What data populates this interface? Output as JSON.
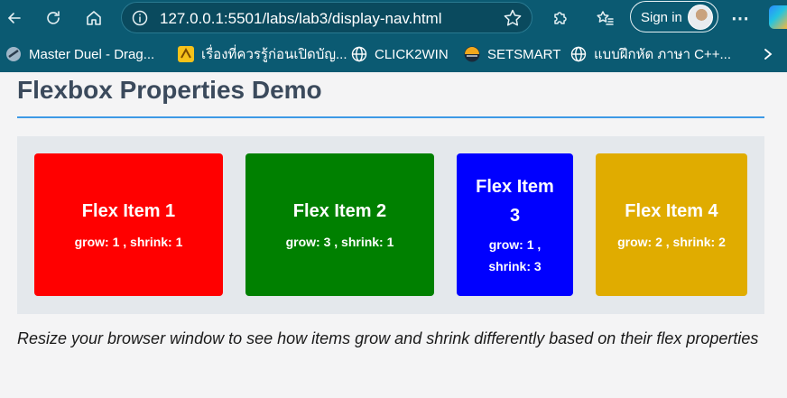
{
  "browser": {
    "url": "127.0.0.1:5501/labs/lab3/display-nav.html",
    "signin_label": "Sign in",
    "more_label": "⋯",
    "bookmarks": [
      {
        "label": "Master Duel - Drag...",
        "icon": "game-icon"
      },
      {
        "label": "เรื่องที่ควรรู้ก่อนเปิดบัญ...",
        "icon": "bank-icon"
      },
      {
        "label": "CLICK2WIN",
        "icon": "globe-icon"
      },
      {
        "label": "SETSMART",
        "icon": "set-logo-icon"
      },
      {
        "label": "แบบฝึกหัด ภาษา C++...",
        "icon": "globe-icon"
      }
    ]
  },
  "page": {
    "title": "Flexbox Properties Demo",
    "items": [
      {
        "title": "Flex Item 1",
        "props": "grow: 1 , shrink: 1",
        "color": "#ff0000"
      },
      {
        "title": "Flex Item 2",
        "props": "grow: 3 , shrink: 1",
        "color": "#008000"
      },
      {
        "title": "Flex Item 3",
        "props": "grow: 1 , shrink: 3",
        "color": "#0000ff"
      },
      {
        "title": "Flex Item 4",
        "props": "grow: 2 , shrink: 2",
        "color": "#e0ac00"
      }
    ],
    "instructions": "Resize your browser window to see how items grow and shrink differently based on their flex properties"
  },
  "colors": {
    "browser_chrome": "#0b5a72",
    "title_text": "#3b4a5c",
    "title_rule": "#3d9ae6",
    "container_bg": "#e4e8ec"
  }
}
